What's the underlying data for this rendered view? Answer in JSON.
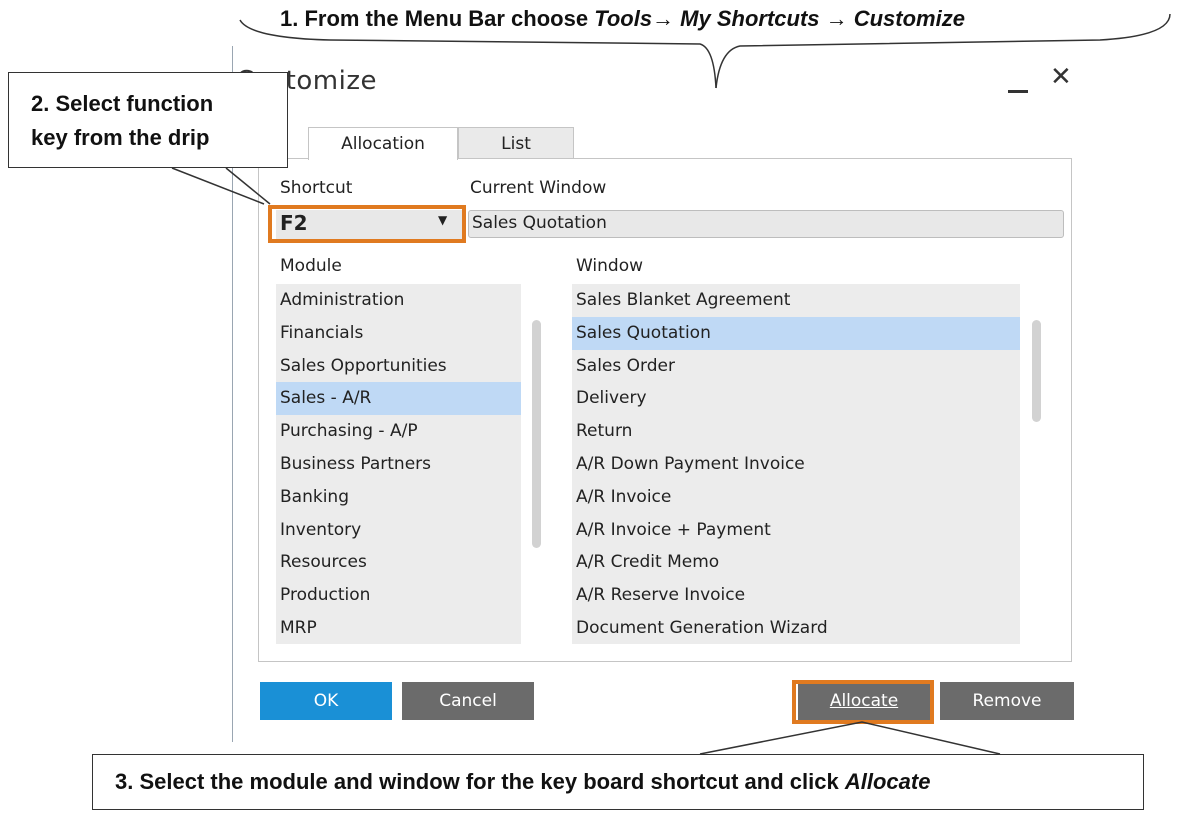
{
  "annotations": {
    "step1": {
      "number": "1.",
      "prefix": "From the Menu Bar choose",
      "path": "Tools→ My Shortcuts → Customize"
    },
    "step2": {
      "line1": "2. Select function",
      "line2": "key from the drip"
    },
    "step3": {
      "number": "3.",
      "text": "Select the module and window for the key board shortcut and click",
      "action": "Allocate"
    },
    "highlight_color": "#e07a20"
  },
  "dialog": {
    "title": "Customize",
    "tabs": [
      {
        "label": "Allocation",
        "active": true
      },
      {
        "label": "List",
        "active": false
      }
    ],
    "shortcut": {
      "label": "Shortcut",
      "value": "F2"
    },
    "current_window": {
      "label": "Current Window",
      "value": "Sales Quotation"
    },
    "module": {
      "label": "Module",
      "items": [
        "Administration",
        "Financials",
        "Sales Opportunities",
        "Sales - A/R",
        "Purchasing - A/P",
        "Business Partners",
        "Banking",
        "Inventory",
        "Resources",
        "Production",
        "MRP"
      ],
      "selected": "Sales - A/R"
    },
    "window": {
      "label": "Window",
      "items": [
        "Sales Blanket Agreement",
        "Sales Quotation",
        "Sales Order",
        "Delivery",
        "Return",
        "A/R Down Payment Invoice",
        "A/R Invoice",
        "A/R Invoice + Payment",
        "A/R Credit Memo",
        "A/R Reserve Invoice",
        "Document Generation Wizard"
      ],
      "selected": "Sales Quotation"
    },
    "buttons": {
      "ok": "OK",
      "cancel": "Cancel",
      "allocate": "Allocate",
      "remove": "Remove"
    },
    "colors": {
      "primary": "#1a90d6",
      "secondary": "#6b6b6b",
      "selection": "#bfd9f5"
    }
  }
}
